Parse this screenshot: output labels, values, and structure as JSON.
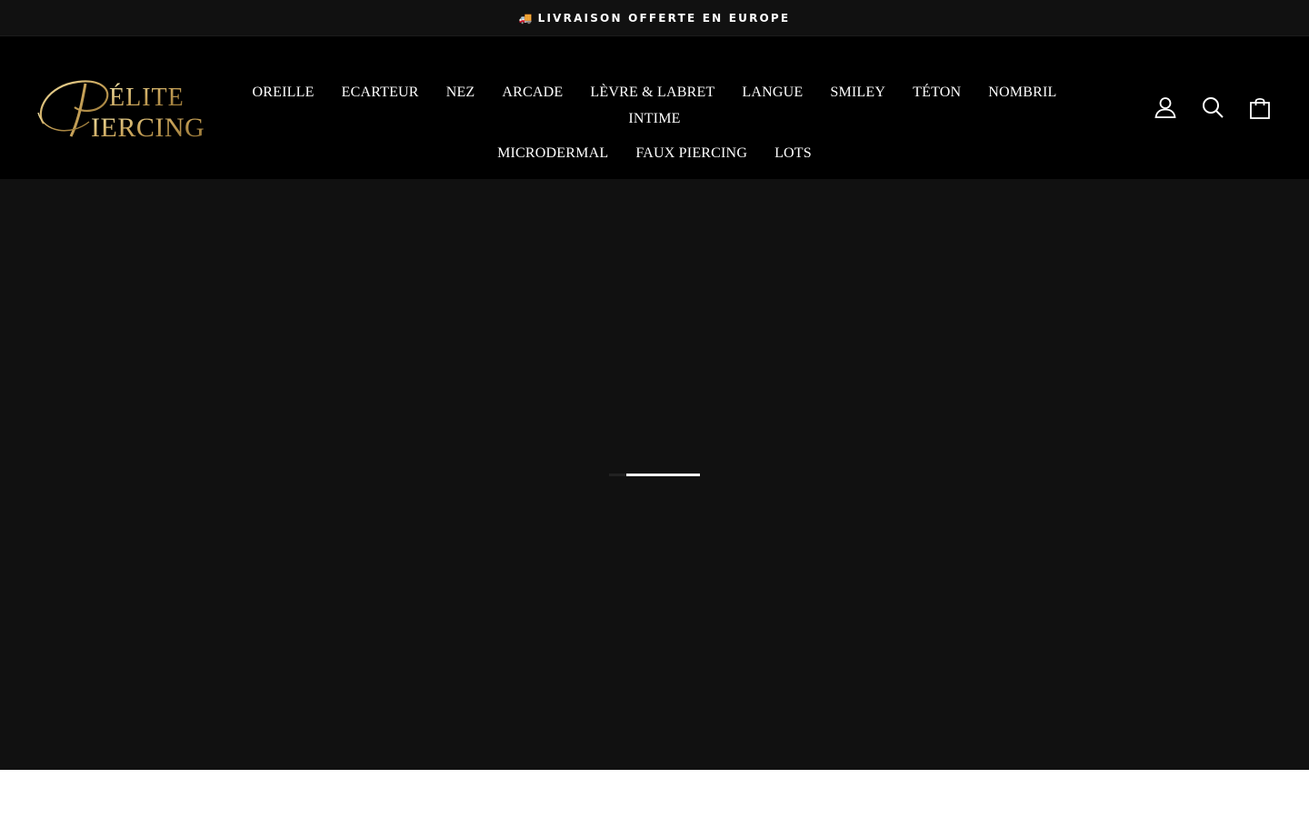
{
  "announcement": {
    "icon": "truck-icon",
    "icon_glyph": "🚚",
    "text": "LIVRAISON OFFERTE EN EUROPE"
  },
  "logo": {
    "text_line1": "ÉLITE",
    "text_line2": "IERCING",
    "initial": "P",
    "color": "#c9b27a"
  },
  "nav": {
    "row1": [
      "OREILLE",
      "ECARTEUR",
      "NEZ",
      "ARCADE",
      "LÈVRE & LABRET",
      "LANGUE",
      "SMILEY",
      "TÉTON",
      "NOMBRIL",
      "INTIME"
    ],
    "row2": [
      "MICRODERMAL",
      "FAUX PIERCING",
      "LOTS"
    ]
  },
  "header_icons": {
    "account": "user-icon",
    "search": "search-icon",
    "cart": "cart-icon"
  },
  "hero": {
    "loader_progress": 0.81,
    "background": "#111111"
  },
  "colors": {
    "announcement_bg": "#111111",
    "header_bg": "#000000",
    "text": "#ffffff",
    "logo_gold": "#c9b27a"
  }
}
